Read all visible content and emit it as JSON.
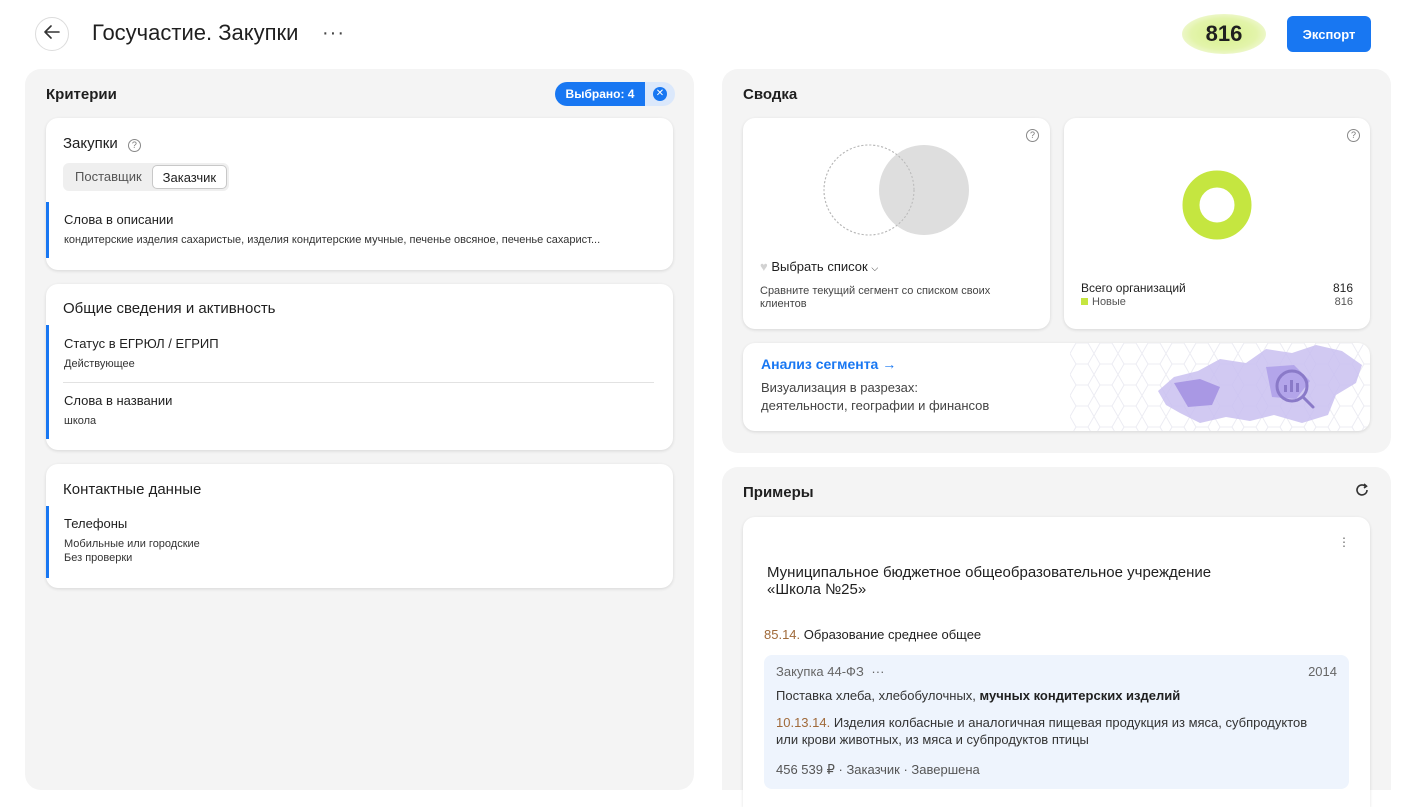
{
  "header": {
    "title": "Госучастие. Закупки",
    "more": "···",
    "count": "816",
    "export_label": "Экспорт"
  },
  "criteria": {
    "title": "Критерии",
    "selected_label": "Выбрано: 4",
    "clear_symbol": "✕",
    "purchases": {
      "title": "Закупки",
      "help": "?",
      "tabs": [
        "Поставщик",
        "Заказчик"
      ],
      "active_tab": "Заказчик",
      "items": [
        {
          "title": "Слова в описании",
          "value": "кондитерские изделия сахаристые, изделия кондитерские мучные, печенье овсяное, печенье сахарист..."
        }
      ]
    },
    "general": {
      "title": "Общие сведения и активность",
      "items": [
        {
          "title": "Статус в ЕГРЮЛ / ЕГРИП",
          "value": "Действующее"
        },
        {
          "title": "Слова в названии",
          "value": "школа"
        }
      ]
    },
    "contacts": {
      "title": "Контактные данные",
      "items": [
        {
          "title": "Телефоны",
          "value1": "Мобильные или городские",
          "value2": "Без проверки"
        }
      ]
    }
  },
  "summary": {
    "title": "Сводка",
    "list_card": {
      "help": "?",
      "select_label": "Выбрать список",
      "description": "Сравните текущий сегмент со списком своих клиентов"
    },
    "org_card": {
      "help": "?",
      "total_label": "Всего организаций",
      "total_value": "816",
      "new_label": "Новые",
      "new_value": "816",
      "donut_color": "#c5e640"
    },
    "analysis": {
      "title": "Анализ сегмента →",
      "desc1": "Визуализация в разрезах:",
      "desc2": "деятельности, географии и финансов"
    }
  },
  "examples": {
    "title": "Примеры",
    "refresh": "C",
    "kebab": "⋮",
    "org_name_line1": "Муниципальное бюджетное общеобразовательное учреждение",
    "org_name_line2": "«Школа №25»",
    "okved_code": "85.14.",
    "okved_text": "Образование среднее общее",
    "purchase": {
      "type": "Закупка 44-ФЗ",
      "more": "···",
      "year": "2014",
      "subject_plain": "Поставка хлеба, хлебобулочных,",
      "subject_bold": "мучных кондитерских изделий",
      "okpd_code": "10.13.14.",
      "okpd_text_line1": "Изделия колбасные и аналогичная пищевая продукция из мяса, субпродуктов",
      "okpd_text_line2": "или крови животных, из мяса и субпродуктов птицы",
      "price": "456 539 ₽",
      "role": "Заказчик",
      "status": "Завершена"
    }
  }
}
